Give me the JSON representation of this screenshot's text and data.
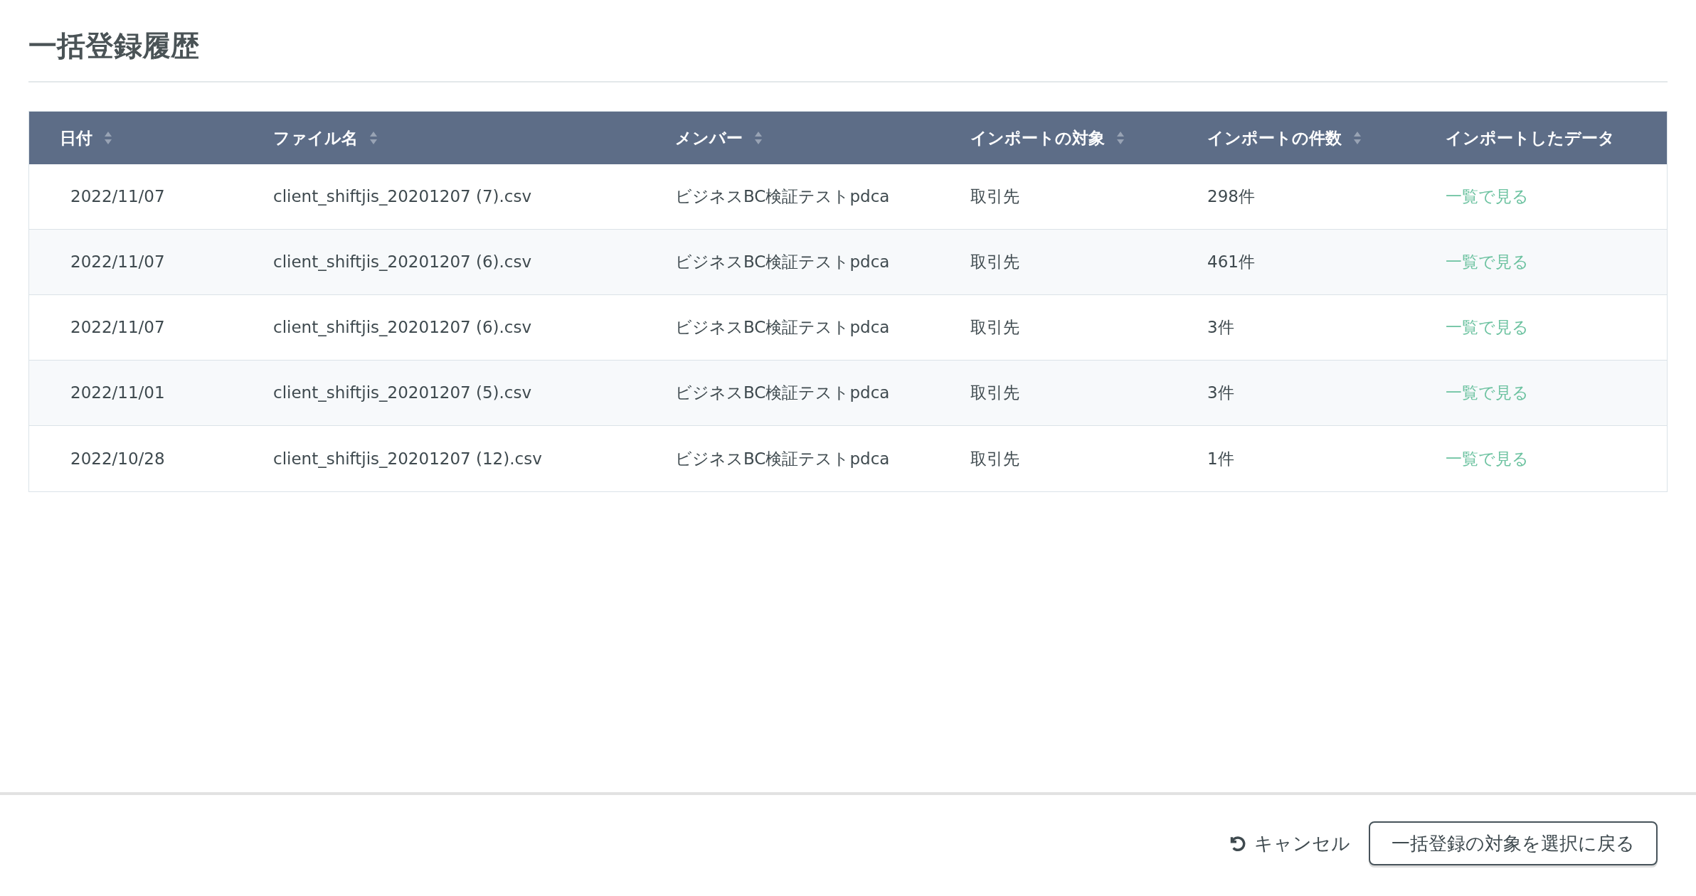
{
  "page_title": "一括登録履歴",
  "table": {
    "columns": [
      {
        "label": "日付",
        "sortable": true
      },
      {
        "label": "ファイル名",
        "sortable": true
      },
      {
        "label": "メンバー",
        "sortable": true
      },
      {
        "label": "インポートの対象",
        "sortable": true
      },
      {
        "label": "インポートの件数",
        "sortable": true
      },
      {
        "label": "インポートしたデータ",
        "sortable": false
      }
    ],
    "rows": [
      {
        "date": "2022/11/07",
        "file": "client_shiftjis_20201207 (7).csv",
        "member": "ビジネスBC検証テストpdca",
        "target": "取引先",
        "count": "298件",
        "link": "一覧で見る"
      },
      {
        "date": "2022/11/07",
        "file": "client_shiftjis_20201207 (6).csv",
        "member": "ビジネスBC検証テストpdca",
        "target": "取引先",
        "count": "461件",
        "link": "一覧で見る"
      },
      {
        "date": "2022/11/07",
        "file": "client_shiftjis_20201207 (6).csv",
        "member": "ビジネスBC検証テストpdca",
        "target": "取引先",
        "count": "3件",
        "link": "一覧で見る"
      },
      {
        "date": "2022/11/01",
        "file": "client_shiftjis_20201207 (5).csv",
        "member": "ビジネスBC検証テストpdca",
        "target": "取引先",
        "count": "3件",
        "link": "一覧で見る"
      },
      {
        "date": "2022/10/28",
        "file": "client_shiftjis_20201207 (12).csv",
        "member": "ビジネスBC検証テストpdca",
        "target": "取引先",
        "count": "1件",
        "link": "一覧で見る"
      }
    ]
  },
  "footer": {
    "cancel": "キャンセル",
    "back_button": "一括登録の対象を選択に戻る"
  }
}
